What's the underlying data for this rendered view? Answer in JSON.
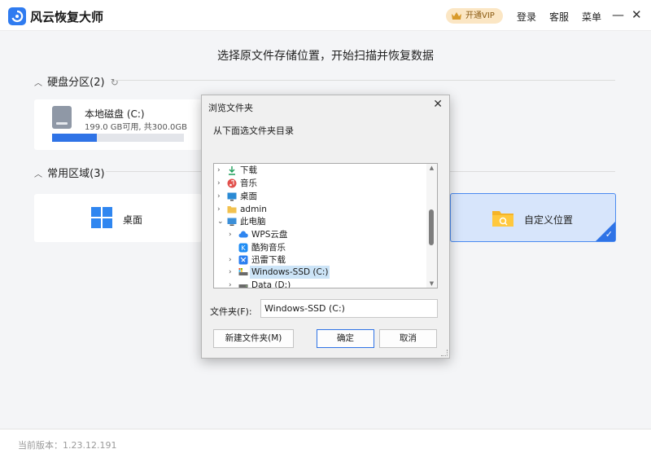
{
  "app": {
    "title": "风云恢复大师",
    "vip_label": "开通VIP",
    "login": "登录",
    "service": "客服",
    "menu": "菜单",
    "minimize": "—",
    "close": "✕"
  },
  "instruction": "选择原文件存储位置，开始扫描并恢复数据",
  "partitions": {
    "heading": "硬盘分区(2)",
    "disk": {
      "name": "本地磁盘 (C:)",
      "size": "199.0 GB可用, 共300.0GB",
      "used_fraction": 0.337
    }
  },
  "common": {
    "heading": "常用区域(3)",
    "desktop": "桌面",
    "custom": "自定义位置"
  },
  "footer": {
    "version": "当前版本：1.23.12.191"
  },
  "dialog": {
    "title": "浏览文件夹",
    "description": "从下面选文件夹目录",
    "tree": [
      {
        "label": "下载",
        "icon": "download-icon",
        "selected": false
      },
      {
        "label": "音乐",
        "icon": "music-icon",
        "selected": false
      },
      {
        "label": "桌面",
        "icon": "desktop-icon",
        "selected": false
      },
      {
        "label": "admin",
        "icon": "folder-icon",
        "selected": false
      },
      {
        "label": "此电脑",
        "icon": "pc-icon",
        "selected": false
      },
      {
        "label": "WPS云盘",
        "icon": "cloud-icon",
        "selected": false
      },
      {
        "label": "酷狗音乐",
        "icon": "kugou-icon",
        "selected": false
      },
      {
        "label": "迅雷下载",
        "icon": "xunlei-icon",
        "selected": false
      },
      {
        "label": "Windows-SSD (C:)",
        "icon": "drive-c-icon",
        "selected": true
      },
      {
        "label": "Data (D:)",
        "icon": "drive-d-icon",
        "selected": false
      }
    ],
    "folder_label": "文件夹(F):",
    "folder_value": "Windows-SSD (C:)",
    "new_folder": "新建文件夹(M)",
    "ok": "确定",
    "cancel": "取消"
  },
  "colors": {
    "accent": "#2f73e6",
    "vip_bg": "#fbe6c4"
  }
}
